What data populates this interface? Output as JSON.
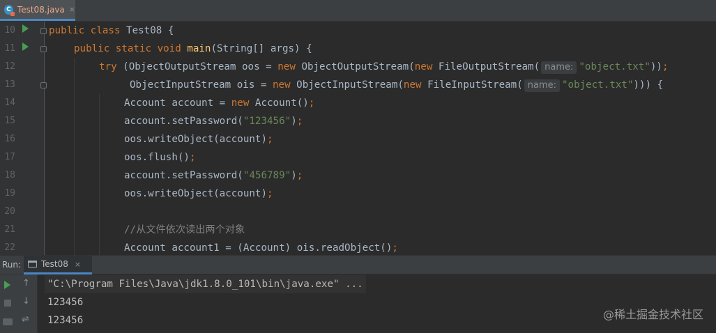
{
  "editor_tab": {
    "label": "Test08.java",
    "icon": "java-class-icon",
    "close": "×"
  },
  "line_numbers": [
    "10",
    "11",
    "12",
    "13",
    "14",
    "15",
    "16",
    "17",
    "18",
    "19",
    "20",
    "21",
    "22"
  ],
  "code": {
    "l10": {
      "kw1": "public class ",
      "rest": "Test08 {"
    },
    "l11": {
      "kw1": "public static void ",
      "fn": "main",
      "rest": "(String[] args) {"
    },
    "l12": {
      "kw1": "try ",
      "p1": "(ObjectOutputStream oos = ",
      "kw2": "new ",
      "p2": "ObjectOutputStream(",
      "kw3": "new ",
      "p3": "FileOutputStream(",
      "hint": "name:",
      "str": "\"object.txt\"",
      "p4": "))",
      "semi": ";"
    },
    "l13": {
      "p1": "ObjectInputStream ois = ",
      "kw2": "new ",
      "p2": "ObjectInputStream(",
      "kw3": "new ",
      "p3": "FileInputStream(",
      "hint": "name:",
      "str": "\"object.txt\"",
      "p4": "))) {"
    },
    "l14": {
      "p1": "Account account = ",
      "kw": "new ",
      "p2": "Account()",
      "semi": ";"
    },
    "l15": {
      "p1": "account.setPassword(",
      "str": "\"123456\"",
      "p2": ")",
      "semi": ";"
    },
    "l16": {
      "p1": "oos.writeObject(account)",
      "semi": ";"
    },
    "l17": {
      "p1": "oos.flush()",
      "semi": ";"
    },
    "l18": {
      "p1": "account.setPassword(",
      "str": "\"456789\"",
      "p2": ")",
      "semi": ";"
    },
    "l19": {
      "p1": "oos.writeObject(account)",
      "semi": ";"
    },
    "l21": {
      "comment": "//从文件依次读出两个对象"
    },
    "l22": {
      "p1": "Account account1 = (Account) ois.readObject()",
      "semi": ";"
    }
  },
  "run_panel": {
    "title": "Run:",
    "tab_label": "Test08",
    "tab_close": "×",
    "tools": {
      "up": "↑",
      "down": "↓",
      "wrap": "⇌"
    },
    "output": [
      "\"C:\\Program Files\\Java\\jdk1.8.0_101\\bin\\java.exe\" ...",
      "123456",
      "123456"
    ]
  },
  "watermark": "@稀土掘金技术社区",
  "colors": {
    "background": "#2b2b2b",
    "keyword": "#cc7832",
    "string": "#6a8759",
    "method": "#ffc66d",
    "comment": "#808080",
    "run_green": "#499c54",
    "accent": "#4a88c7"
  }
}
